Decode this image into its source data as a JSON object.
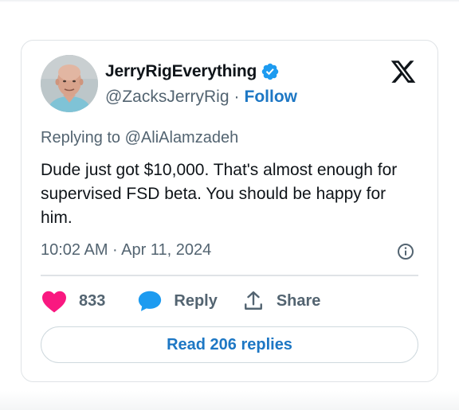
{
  "author": {
    "display_name": "JerryRigEverything",
    "handle": "@ZacksJerryRig",
    "separator": "·",
    "follow_label": "Follow",
    "verified": true
  },
  "reply_context": {
    "prefix": "Replying to ",
    "mention": "@AliAlamzadeh"
  },
  "tweet": {
    "text": "Dude just got $10,000. That's almost enough for supervised FSD beta. You should be happy for him.",
    "timestamp": "10:02 AM · Apr 11, 2024"
  },
  "actions": {
    "like_count": "833",
    "reply_label": "Reply",
    "share_label": "Share"
  },
  "read_replies_label": "Read 206 replies",
  "colors": {
    "link_blue": "#1d77c4",
    "verified_blue": "#1d9bf0",
    "like_pink": "#f91880",
    "secondary_text": "#536471",
    "primary_text": "#0f1419",
    "border": "#dfe3e6"
  },
  "icons": {
    "logo": "x-logo-icon",
    "verified": "verified-badge-icon",
    "info": "info-icon",
    "like": "heart-icon",
    "reply": "speech-bubble-icon",
    "share": "share-upload-icon"
  }
}
